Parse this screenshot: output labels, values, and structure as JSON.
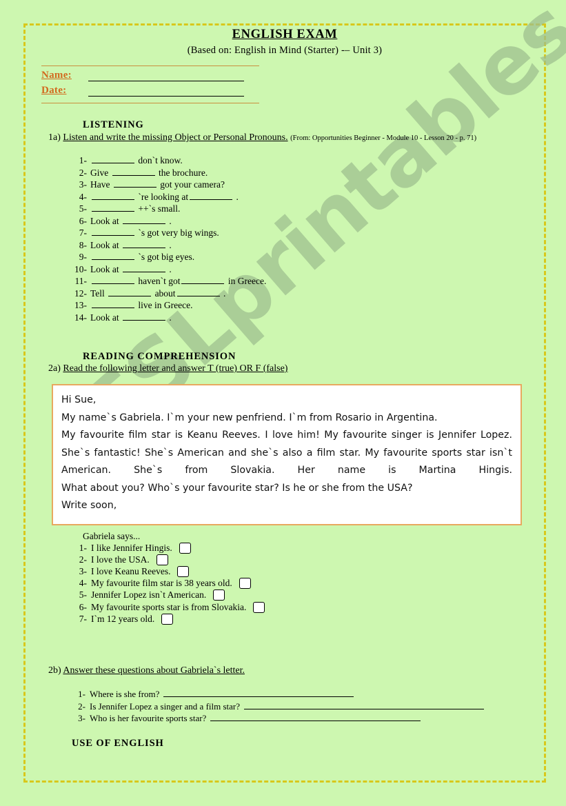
{
  "page": {
    "background_color": "#cdf7b0",
    "frame_color": "#d8c81c",
    "accent_color": "#d2691e",
    "letter_border_color": "#e8a85f",
    "watermark_text": "ESLprintables.com"
  },
  "header": {
    "title": "ENGLISH EXAM",
    "subtitle": "(Based on: English in Mind (Starter) -– Unit 3)"
  },
  "identity": {
    "name_label": "Name:",
    "date_label": "Date:",
    "name_value": "",
    "date_value": ""
  },
  "listening": {
    "heading": "LISTENING",
    "task_number": "1a)",
    "task_prompt": "Listen and write the missing Object or Personal Pronouns.",
    "source_note": "(From: Opportunities Beginner - Module 10 - Lesson 20 - p. 71)",
    "items": [
      {
        "num": "1-",
        "before": "",
        "after": "don`t know."
      },
      {
        "num": "2-",
        "before": "Give",
        "after": "the brochure."
      },
      {
        "num": "3-",
        "before": "Have",
        "after": "got your camera?"
      },
      {
        "num": "4-",
        "before": "",
        "after": "`re looking at",
        "trailing_blank": true,
        "end": "."
      },
      {
        "num": "5-",
        "before": "",
        "after": "++`s small."
      },
      {
        "num": "6-",
        "before": "Look at",
        "after": "."
      },
      {
        "num": "7-",
        "before": "",
        "after": "`s got very big wings."
      },
      {
        "num": "8-",
        "before": "Look at",
        "after": "."
      },
      {
        "num": "9-",
        "before": "",
        "after": "`s got big eyes."
      },
      {
        "num": "10-",
        "before": "Look at",
        "after": "."
      },
      {
        "num": "11-",
        "before": "",
        "after": "haven`t got",
        "trailing_blank": true,
        "end": "in Greece."
      },
      {
        "num": "12-",
        "before": "Tell",
        "after": "about",
        "trailing_blank": true,
        "end": "."
      },
      {
        "num": "13-",
        "before": "",
        "after": "live in Greece."
      },
      {
        "num": "14-",
        "before": "Look at",
        "after": "."
      }
    ]
  },
  "reading": {
    "heading": "READING COMPREHENSION",
    "task_number": "2a)",
    "task_prompt": "Read the following letter and answer T (true) OR F (false)",
    "letter": {
      "greeting": "Hi Sue,",
      "paragraphs": [
        "My name`s Gabriela. I`m your new penfriend. I`m from Rosario in Argentina.",
        "My favourite film star is Keanu Reeves. I love him! My favourite singer is Jennifer Lopez. She`s fantastic! She`s American and she`s also a film star. My favourite sports star isn`t American. She`s from Slovakia. Her name is Martina Hingis.",
        "What about you? Who`s your favourite star? Is he or she from the USA?",
        "Write soon,"
      ]
    },
    "statements_caption": "Gabriela says...",
    "statements": [
      {
        "num": "1-",
        "text": "I like Jennifer Hingis.",
        "checked": false
      },
      {
        "num": "2-",
        "text": "I love the USA.",
        "checked": false
      },
      {
        "num": "3-",
        "text": "I love Keanu Reeves.",
        "checked": false
      },
      {
        "num": "4-",
        "text": "My favourite film star is 38 years old.",
        "checked": false
      },
      {
        "num": "5-",
        "text": "Jennifer Lopez isn`t American.",
        "checked": false
      },
      {
        "num": "6-",
        "text": "My favourite sports star is from Slovakia.",
        "checked": false
      },
      {
        "num": "7-",
        "text": "I`m 12 years old.",
        "checked": false
      }
    ]
  },
  "questions": {
    "task_number": "2b)",
    "task_prompt": "Answer these questions about Gabriela`s letter.",
    "items": [
      {
        "num": "1-",
        "text": "Where is she from?",
        "answer": "",
        "line_width": 276
      },
      {
        "num": "2-",
        "text": "Is Jennifer Lopez a singer and a film star?",
        "answer": "",
        "line_width": 348
      },
      {
        "num": "3-",
        "text": "Who is her favourite sports star?",
        "answer": "",
        "line_width": 305
      }
    ]
  },
  "use_of_english": {
    "heading": "USE OF ENGLISH"
  }
}
